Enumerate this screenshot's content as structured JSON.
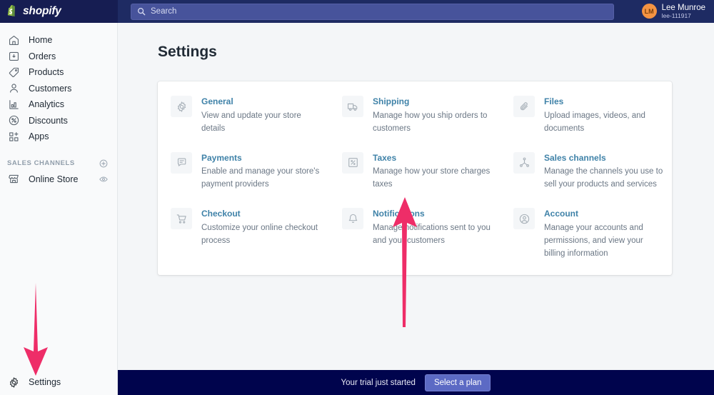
{
  "topbar": {
    "brand": "shopify",
    "logo_icon": "shopify-bag-icon",
    "search": {
      "icon": "search-icon",
      "placeholder": "Search",
      "value": ""
    },
    "user": {
      "initials": "LM",
      "name": "Lee Munroe",
      "handle": "lee-111917"
    }
  },
  "sidebar": {
    "items": [
      {
        "label": "Home",
        "icon": "home-icon"
      },
      {
        "label": "Orders",
        "icon": "orders-inbox-icon"
      },
      {
        "label": "Products",
        "icon": "tag-icon"
      },
      {
        "label": "Customers",
        "icon": "person-icon"
      },
      {
        "label": "Analytics",
        "icon": "bar-chart-icon"
      },
      {
        "label": "Discounts",
        "icon": "discount-percent-icon"
      },
      {
        "label": "Apps",
        "icon": "apps-grid-icon"
      }
    ],
    "section": {
      "title": "SALES CHANNELS",
      "add_icon": "plus-circle-icon"
    },
    "channels": [
      {
        "label": "Online Store",
        "icon": "storefront-icon",
        "action_icon": "eye-icon"
      }
    ],
    "footer": {
      "label": "Settings",
      "icon": "gear-icon"
    }
  },
  "main": {
    "title": "Settings",
    "columns": [
      {
        "rows": [
          {
            "icon": "gear-icon",
            "link": "General",
            "desc": "View and update your store details"
          },
          {
            "icon": "payments-card-icon",
            "link": "Payments",
            "desc": "Enable and manage your store's payment providers"
          },
          {
            "icon": "shopping-cart-icon",
            "link": "Checkout",
            "desc": "Customize your online checkout process"
          }
        ]
      },
      {
        "rows": [
          {
            "icon": "shipping-truck-icon",
            "link": "Shipping",
            "desc": "Manage how you ship orders to customers"
          },
          {
            "icon": "taxes-percent-box-icon",
            "link": "Taxes",
            "desc": "Manage how your store charges taxes"
          },
          {
            "icon": "bell-icon",
            "link": "Notifications",
            "desc": "Manage notifications sent to you and your customers"
          }
        ]
      },
      {
        "rows": [
          {
            "icon": "paperclip-icon",
            "link": "Files",
            "desc": "Upload images, videos, and documents"
          },
          {
            "icon": "sales-channels-node-icon",
            "link": "Sales channels",
            "desc": "Manage the channels you use to sell your products and services"
          },
          {
            "icon": "account-circle-icon",
            "link": "Account",
            "desc": "Manage your accounts and permissions, and view your billing information"
          }
        ]
      }
    ]
  },
  "bottombar": {
    "trial_text": "Your trial just started",
    "plan_button": "Select a plan"
  },
  "annotations": {
    "arrows": [
      {
        "name": "arrow-pointing-to-settings",
        "direction": "down",
        "color": "#ee2d68"
      },
      {
        "name": "arrow-pointing-to-notifications",
        "direction": "up",
        "color": "#ee2d68"
      }
    ]
  },
  "colors": {
    "header_bg": "#1e2b63",
    "logo_bg": "#161d52",
    "sidebar_bg": "#f9fafb",
    "content_bg": "#f4f6f8",
    "card_bg": "#ffffff",
    "link_blue": "#3f82a8",
    "banner_bg": "#00044d",
    "plan_button_bg": "#5c6ac4",
    "avatar_bg": "#f49342",
    "arrow_pink": "#ee2d68"
  }
}
